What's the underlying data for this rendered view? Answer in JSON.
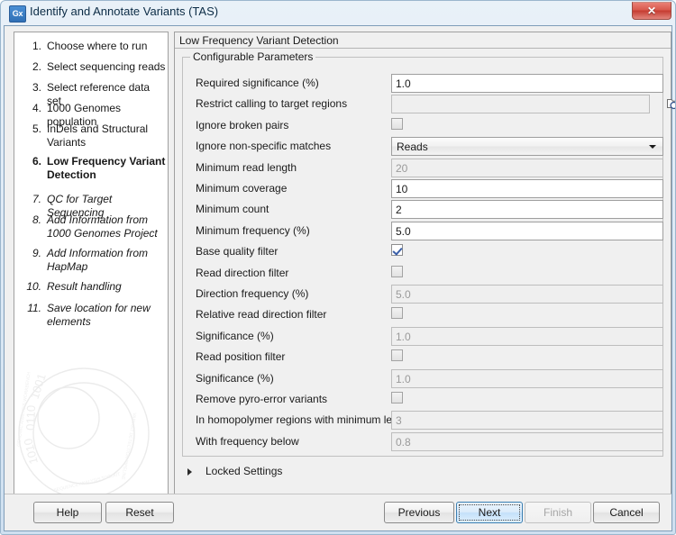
{
  "window": {
    "title": "Identify and Annotate Variants (TAS)",
    "app_icon_label": "Gx",
    "close_label": "✕"
  },
  "sidebar": {
    "steps": [
      {
        "num": "1.",
        "label": "Choose where to run",
        "state": "done"
      },
      {
        "num": "2.",
        "label": "Select sequencing reads",
        "state": "done"
      },
      {
        "num": "3.",
        "label": "Select reference data set",
        "state": "done"
      },
      {
        "num": "4.",
        "label": "1000 Genomes population",
        "state": "done"
      },
      {
        "num": "5.",
        "label": "InDels and Structural Variants",
        "state": "done"
      },
      {
        "num": "6.",
        "label": "Low Frequency Variant Detection",
        "state": "current"
      },
      {
        "num": "7.",
        "label": "QC for Target Sequencing",
        "state": "future"
      },
      {
        "num": "8.",
        "label": "Add Information from 1000 Genomes Project",
        "state": "future"
      },
      {
        "num": "9.",
        "label": "Add Information from HapMap",
        "state": "future"
      },
      {
        "num": "10.",
        "label": "Result handling",
        "state": "future"
      },
      {
        "num": "11.",
        "label": "Save location for new elements",
        "state": "future"
      }
    ]
  },
  "panel": {
    "header": "Low Frequency Variant Detection",
    "groupbox_title": "Configurable Parameters",
    "locked_settings_label": "Locked Settings",
    "parameters": [
      {
        "label": "Required significance (%)",
        "type": "text",
        "value": "1.0",
        "enabled": true
      },
      {
        "label": "Restrict calling to target regions",
        "type": "browse",
        "value": "",
        "enabled": false
      },
      {
        "label": "Ignore broken pairs",
        "type": "checkbox",
        "value": "",
        "checked": false,
        "enabled": true
      },
      {
        "label": "Ignore non-specific matches",
        "type": "dropdown",
        "value": "Reads",
        "enabled": true
      },
      {
        "label": "Minimum read length",
        "type": "text",
        "value": "20",
        "enabled": false
      },
      {
        "label": "Minimum coverage",
        "type": "text",
        "value": "10",
        "enabled": true
      },
      {
        "label": "Minimum count",
        "type": "text",
        "value": "2",
        "enabled": true
      },
      {
        "label": "Minimum frequency (%)",
        "type": "text",
        "value": "5.0",
        "enabled": true
      },
      {
        "label": "Base quality filter",
        "type": "checkbox",
        "value": "",
        "checked": true,
        "enabled": true
      },
      {
        "label": "Read direction filter",
        "type": "checkbox",
        "value": "",
        "checked": false,
        "enabled": true
      },
      {
        "label": "Direction frequency (%)",
        "type": "text",
        "value": "5.0",
        "enabled": false
      },
      {
        "label": "Relative read direction filter",
        "type": "checkbox",
        "value": "",
        "checked": false,
        "enabled": true
      },
      {
        "label": "Significance (%)",
        "type": "text",
        "value": "1.0",
        "enabled": false
      },
      {
        "label": "Read position filter",
        "type": "checkbox",
        "value": "",
        "checked": false,
        "enabled": true
      },
      {
        "label": "Significance (%)",
        "type": "text",
        "value": "1.0",
        "enabled": false
      },
      {
        "label": "Remove pyro-error variants",
        "type": "checkbox",
        "value": "",
        "checked": false,
        "enabled": true
      },
      {
        "label": "In homopolymer regions with minimum length",
        "type": "text",
        "value": "3",
        "enabled": false
      },
      {
        "label": "With frequency below",
        "type": "text",
        "value": "0.8",
        "enabled": false
      }
    ]
  },
  "buttons": {
    "help": "Help",
    "reset": "Reset",
    "previous": "Previous",
    "next": "Next",
    "finish": "Finish",
    "cancel": "Cancel"
  },
  "colors": {
    "accent": "#3c7fb1",
    "close_button": "#c53c31",
    "checkmark": "#3a5fa8",
    "titlebar_text": "#0b2b45"
  }
}
